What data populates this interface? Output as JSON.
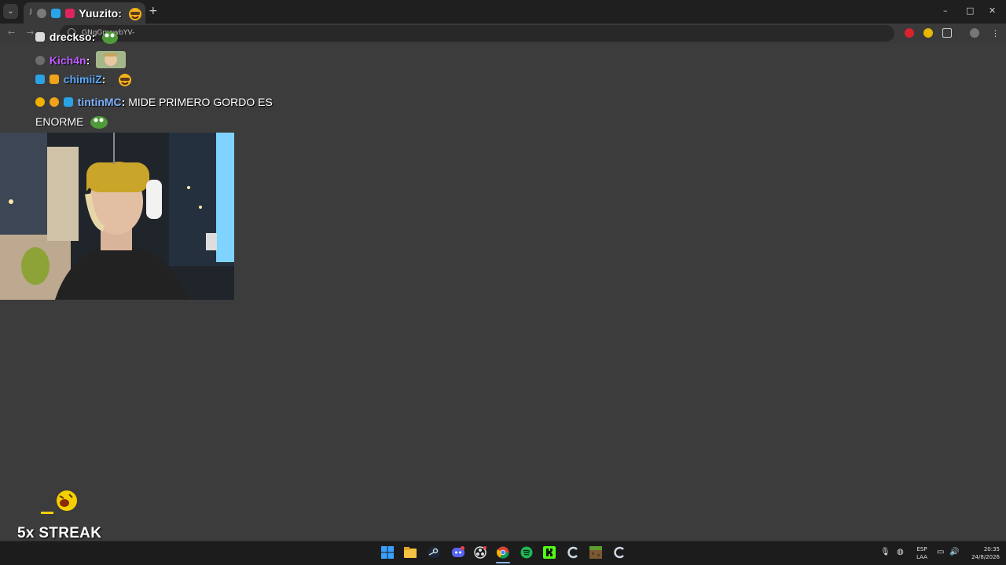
{
  "browser": {
    "tab_title": "J",
    "new_tab_symbol": "+",
    "url": "GNgGmswbYV-",
    "window_controls": {
      "minimize": "–",
      "maximize": "□",
      "close": "✕"
    },
    "nav": {
      "back": "←",
      "forward": "→"
    }
  },
  "chat": {
    "messages": [
      {
        "user": "Yuuzito",
        "color": "#ffffff",
        "text": ""
      },
      {
        "user": "drecksо",
        "color": "#ffffff",
        "text": ""
      },
      {
        "user": "Kich4n",
        "color": "#c05bff",
        "text": ""
      },
      {
        "user": "chimiiZ",
        "color": "#5aa9ff",
        "text": ""
      },
      {
        "user": "tintinMC",
        "color": "#7fb2ff",
        "text": "MIDE PRIMERO GORDO ES",
        "text_cont": "ENORME"
      }
    ],
    "separator": ":"
  },
  "streak": {
    "label": "5x STREAK"
  },
  "taskbar": {
    "apps": [
      "windows-start",
      "file-explorer",
      "steam",
      "discord",
      "obs",
      "chrome",
      "spotify",
      "kick",
      "app-c",
      "minecraft",
      "app-c2"
    ],
    "tray": {
      "language": "ESP",
      "layout": "LAA",
      "time": "20:35",
      "date": "24/8/2026"
    }
  }
}
